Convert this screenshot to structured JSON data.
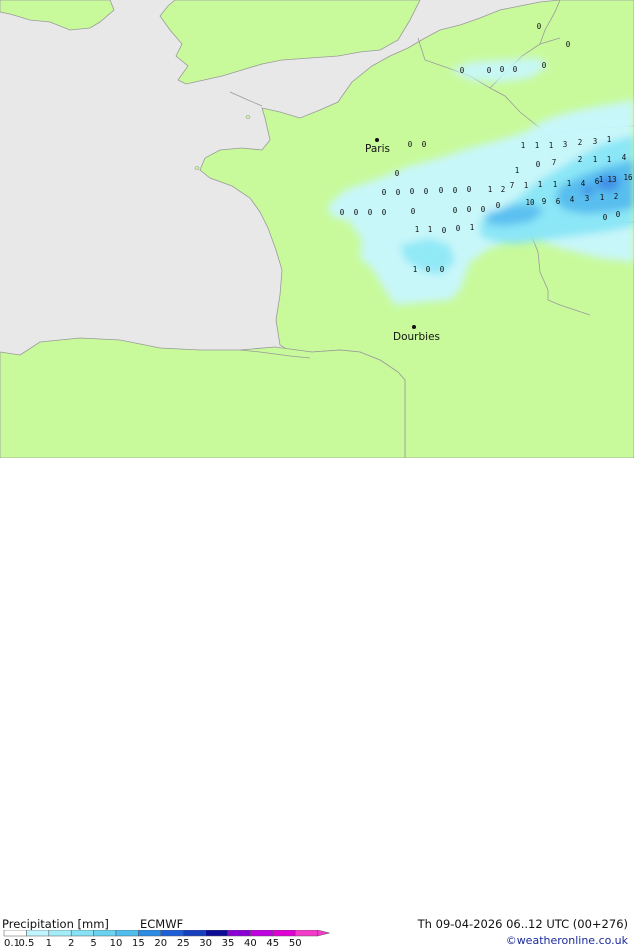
{
  "title": {
    "left_label": "Precipitation [mm]",
    "model": "ECMWF",
    "valid": "Th 09-04-2026 06..12 UTC (00+276)"
  },
  "credit": "©weatheronline.co.uk",
  "colors": {
    "sea": "#e8e8e8",
    "land": "#c8fa9c",
    "border": "#9a9a9a",
    "precip_light": "#c8f7ff",
    "precip_mid": "#88e6f6",
    "precip_heavy": "#52b9ee"
  },
  "cities": [
    {
      "name": "Paris"
    },
    {
      "name": "Dourbies"
    }
  ],
  "legend": {
    "ticks": [
      "0.1",
      "0.5",
      "1",
      "2",
      "5",
      "10",
      "15",
      "20",
      "25",
      "30",
      "35",
      "40",
      "45",
      "50"
    ],
    "colors": [
      "#ffffff",
      "#c0f4ff",
      "#a4ecf8",
      "#86e2f4",
      "#6ad4f0",
      "#4fbeee",
      "#2d8ce6",
      "#1e5fd8",
      "#163fbe",
      "#0c0c96",
      "#8b00d6",
      "#bf00e0",
      "#e000d4",
      "#f43ac8"
    ]
  },
  "values": [
    "0",
    "0",
    "0",
    "0",
    "0",
    "0",
    "0",
    "0",
    "0",
    "0",
    "0",
    "0",
    "0",
    "0",
    "0",
    "0",
    "0",
    "0",
    "0",
    "0",
    "0",
    "0",
    "0",
    "0",
    "0",
    "1",
    "1",
    "1",
    "3",
    "2",
    "3",
    "1",
    "2",
    "1",
    "1",
    "4",
    "7",
    "7",
    "1",
    "1",
    "1",
    "1",
    "4",
    "6",
    "13",
    "16",
    "1",
    "0",
    "10",
    "9",
    "6",
    "4",
    "3",
    "1",
    "2",
    "1",
    "2",
    "1",
    "0",
    "0",
    "0",
    "1",
    "1",
    "0",
    "0",
    "1",
    "1",
    "0",
    "0"
  ]
}
